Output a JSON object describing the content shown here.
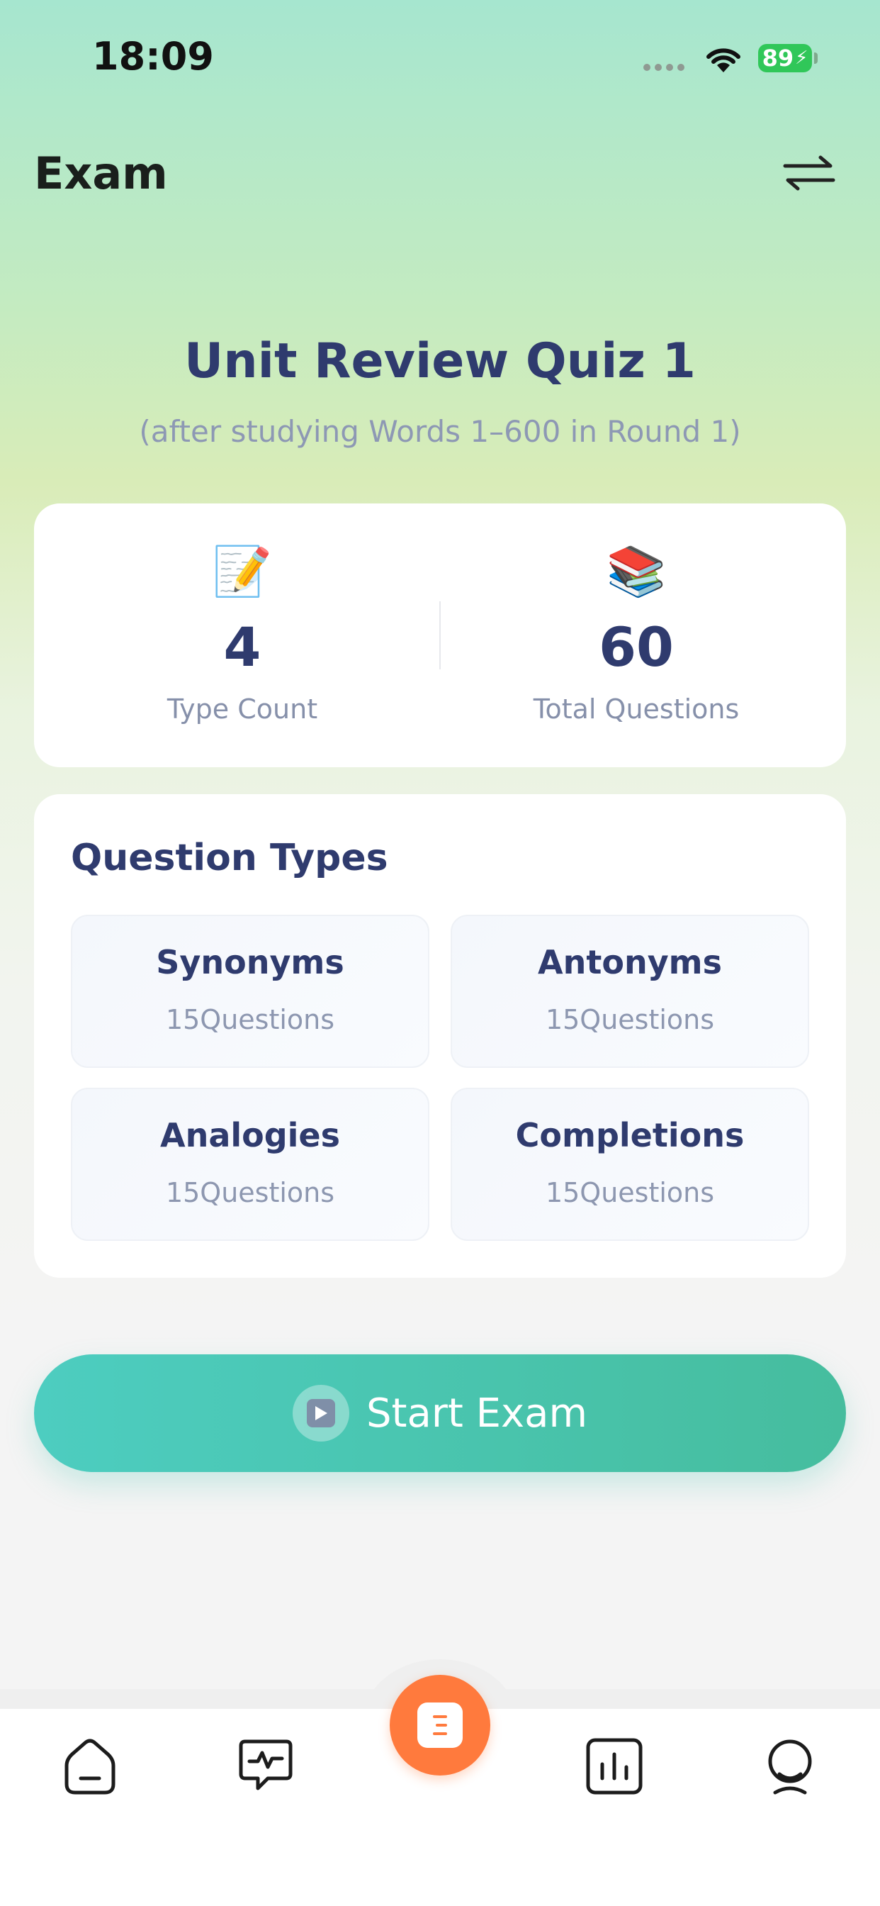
{
  "status_bar": {
    "time": "18:09",
    "battery": "89"
  },
  "header": {
    "title": "Exam",
    "switch_icon": "swap-arrows-icon"
  },
  "quiz": {
    "title": "Unit Review Quiz 1",
    "subtitle": "(after studying Words 1–600 in Round 1)"
  },
  "stats": [
    {
      "emoji": "📝",
      "icon": "memo-icon",
      "value": "4",
      "label": "Type Count"
    },
    {
      "emoji": "📚",
      "icon": "books-icon",
      "value": "60",
      "label": "Total Questions"
    }
  ],
  "question_types": {
    "title": "Question Types",
    "items": [
      {
        "name": "Synonyms",
        "count": "15Questions"
      },
      {
        "name": "Antonyms",
        "count": "15Questions"
      },
      {
        "name": "Analogies",
        "count": "15Questions"
      },
      {
        "name": "Completions",
        "count": "15Questions"
      }
    ]
  },
  "start_button": {
    "label": "Start Exam",
    "icon": "play-icon"
  },
  "tab_bar": {
    "items": [
      {
        "icon": "home-icon"
      },
      {
        "icon": "chat-icon"
      },
      {
        "icon": "book-icon",
        "active": true,
        "accent": "#ff7a3d"
      },
      {
        "icon": "stats-icon"
      },
      {
        "icon": "profile-icon"
      }
    ]
  },
  "colors": {
    "accent_teal": "#46bd9e",
    "title_navy": "#2f3b6e",
    "tab_orange": "#ff7a3d"
  }
}
